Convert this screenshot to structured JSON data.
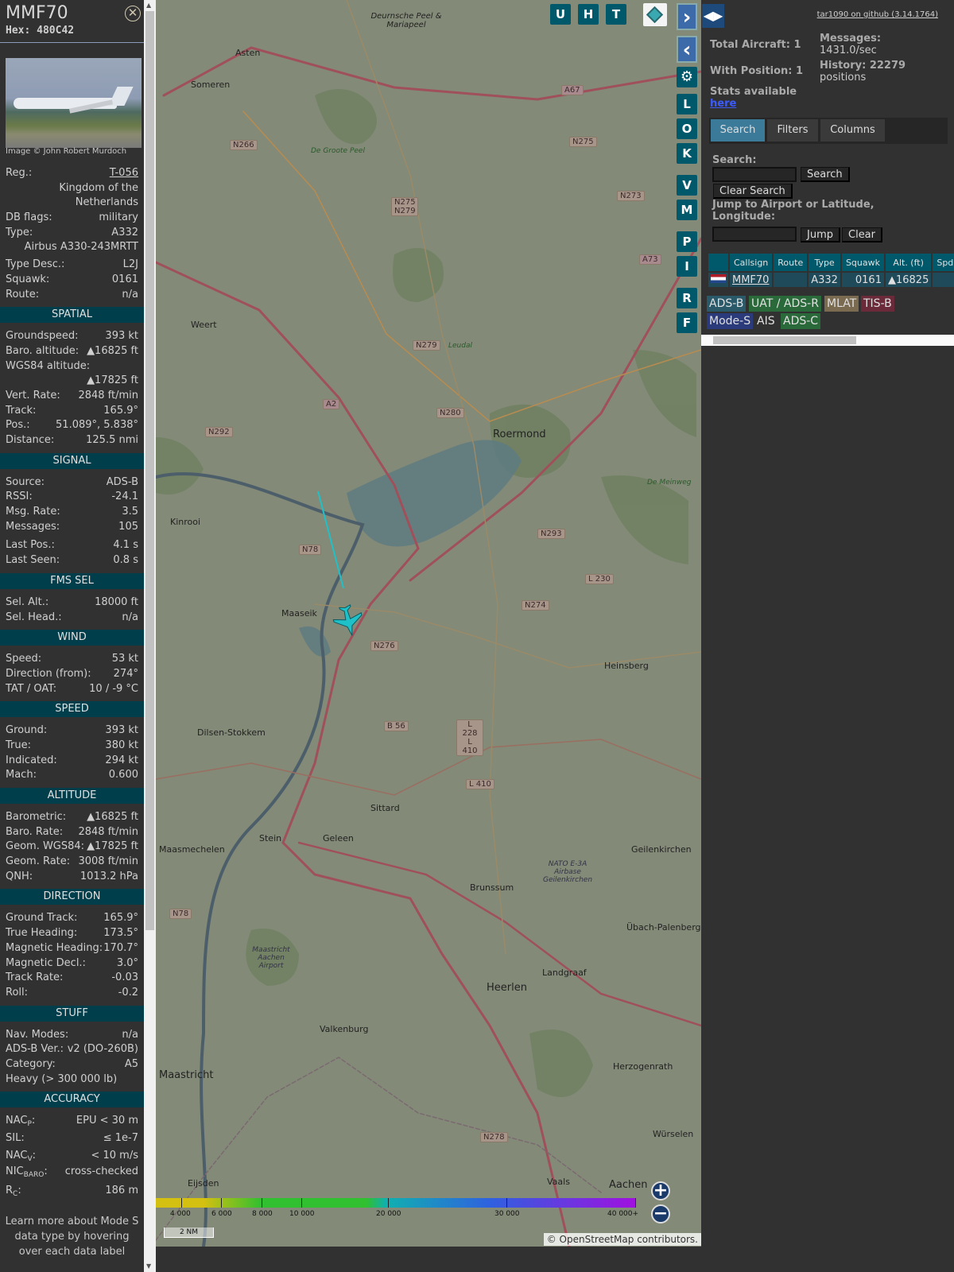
{
  "aircraft": {
    "callsign": "MMF70",
    "hex": "Hex: 480C42",
    "photo_credit": "Image © John Robert Murdoch",
    "reg_label": "Reg.:",
    "reg": "T-056",
    "country_1": "Kingdom of the",
    "country_2": "Netherlands",
    "db_flags_label": "DB flags:",
    "db_flags": "military",
    "type_label": "Type:",
    "type": "A332",
    "type_name": "Airbus A330-243MRTT",
    "type_desc_label": "Type Desc.:",
    "type_desc": "L2J",
    "squawk_label": "Squawk:",
    "squawk": "0161",
    "route_label": "Route:",
    "route": "n/a"
  },
  "sections": {
    "spatial": {
      "title": "SPATIAL",
      "rows": [
        [
          "Groundspeed:",
          "393 kt"
        ],
        [
          "Baro. altitude:",
          "▲16825 ft"
        ],
        [
          "WGS84 altitude:",
          ""
        ],
        [
          "",
          "▲17825 ft"
        ],
        [
          "Vert. Rate:",
          "2848 ft/min"
        ],
        [
          "Track:",
          "165.9°"
        ],
        [
          "Pos.:",
          "51.089°, 5.838°"
        ],
        [
          "Distance:",
          "125.5 nmi"
        ]
      ]
    },
    "signal": {
      "title": "SIGNAL",
      "rows": [
        [
          "Source:",
          "ADS-B"
        ],
        [
          "RSSI:",
          "-24.1"
        ],
        [
          "Msg. Rate:",
          "3.5"
        ],
        [
          "Messages:",
          "105"
        ],
        [
          "Last Pos.:",
          "4.1 s"
        ],
        [
          "Last Seen:",
          "0.8 s"
        ]
      ]
    },
    "fms": {
      "title": "FMS SEL",
      "rows": [
        [
          "Sel. Alt.:",
          "18000 ft"
        ],
        [
          "Sel. Head.:",
          "n/a"
        ]
      ]
    },
    "wind": {
      "title": "WIND",
      "rows": [
        [
          "Speed:",
          "53 kt"
        ],
        [
          "Direction (from):",
          "274°"
        ],
        [
          "TAT / OAT:",
          "10 / -9 °C"
        ]
      ]
    },
    "speed": {
      "title": "SPEED",
      "rows": [
        [
          "Ground:",
          "393 kt"
        ],
        [
          "True:",
          "380 kt"
        ],
        [
          "Indicated:",
          "294 kt"
        ],
        [
          "Mach:",
          "0.600"
        ]
      ]
    },
    "altitude": {
      "title": "ALTITUDE",
      "rows": [
        [
          "Barometric:",
          "▲16825 ft"
        ],
        [
          "Baro. Rate:",
          "2848 ft/min"
        ],
        [
          "Geom. WGS84:",
          "▲17825 ft"
        ],
        [
          "Geom. Rate:",
          "3008 ft/min"
        ],
        [
          "QNH:",
          "1013.2 hPa"
        ]
      ]
    },
    "direction": {
      "title": "DIRECTION",
      "rows": [
        [
          "Ground Track:",
          "165.9°"
        ],
        [
          "True Heading:",
          "173.5°"
        ],
        [
          "Magnetic Heading:",
          "170.7°"
        ],
        [
          "Magnetic Decl.:",
          "3.0°"
        ],
        [
          "Track Rate:",
          "-0.03"
        ],
        [
          "Roll:",
          "-0.2"
        ]
      ]
    },
    "stuff": {
      "title": "STUFF",
      "rows": [
        [
          "Nav. Modes:",
          "n/a"
        ],
        [
          "ADS-B Ver.:",
          "v2 (DO-260B)"
        ],
        [
          "Category:",
          "A5"
        ]
      ],
      "category_desc": "Heavy (> 300 000 lb)"
    },
    "accuracy": {
      "title": "ACCURACY",
      "nacp": "NAC",
      "nacp_sub": "P",
      "nacp_val": "EPU < 30 m",
      "sil": "SIL:",
      "sil_val": "≤ 1e-7",
      "nacv": "NAC",
      "nacv_sub": "V",
      "nacv_val": "< 10 m/s",
      "nicbaro": "NIC",
      "nicbaro_sub": "BARO",
      "nicbaro_val": "cross-checked",
      "rc": "R",
      "rc_sub": "C",
      "rc_val": "186 m"
    },
    "learn_more": "Learn more about Mode S data type by hovering over each data label"
  },
  "map": {
    "buttons_top": [
      "U",
      "H",
      "T"
    ],
    "buttons_side": [
      "L",
      "O",
      "K",
      "V",
      "M",
      "P",
      "I",
      "R",
      "F"
    ],
    "places": [
      "Asten",
      "Someren",
      "Weert",
      "Kinrooi",
      "Maaseik",
      "Roermond",
      "Dilsen-Stokkem",
      "Sittard",
      "Geleen",
      "Stein",
      "Maasmechelen",
      "Brunssum",
      "Heinsberg",
      "Geilenkirchen",
      "Übach-Palenberg",
      "Landgraaf",
      "Heerlen",
      "Valkenburg",
      "Maastricht",
      "Herzogenrath",
      "Würselen",
      "Eijsden",
      "Vaals",
      "Aachen",
      "Deurnsche Peel & Mariapeel",
      "De Groote Peel",
      "Leudal",
      "De Meinweg",
      "NATO E-3A Airbase Geilenkirchen",
      "Maastricht Aachen Airport"
    ],
    "shields": [
      "N266",
      "N275",
      "N275 N279",
      "N273",
      "A67",
      "A73",
      "N279",
      "A2",
      "N280",
      "N292",
      "N78",
      "N293",
      "L 230",
      "N274",
      "N276",
      "B 56",
      "L 228 L 410",
      "L 410",
      "N78",
      "N278"
    ],
    "colorbar_ticks": [
      "4 000",
      "6 000",
      "8 000",
      "10 000",
      "20 000",
      "30 000",
      "40 000+"
    ],
    "scale": "2 NM",
    "attribution_prefix": "© ",
    "attribution_link": "OpenStreetMap",
    "attribution_suffix": " contributors."
  },
  "right": {
    "github": "tar1090 on github (3.14.1764)",
    "total_aircraft": "Total Aircraft: 1",
    "with_position": "With Position: 1",
    "stats_available": "Stats available",
    "stats_link": "here",
    "messages_label": "Messages:",
    "messages": "1431.0/sec",
    "history_label": "History: 22279",
    "history_unit": "positions",
    "tabs": [
      "Search",
      "Filters",
      "Columns"
    ],
    "search_label": "Search:",
    "search_value": "",
    "search_button": "Search",
    "clear_search": "Clear Search",
    "jump_label": "Jump to Airport or Latitude, Longitude:",
    "jump_value": "",
    "jump_button": "Jump",
    "clear_button": "Clear",
    "table": {
      "headers": [
        "",
        "Callsign",
        "Route",
        "Type",
        "Squawk",
        "Alt. (ft)",
        "Spd"
      ],
      "rows": [
        {
          "callsign": "MMF70",
          "route": "",
          "type": "A332",
          "squawk": "0161",
          "alt": "▲16825",
          "spd": ""
        }
      ]
    },
    "sources": [
      "ADS-B",
      "UAT / ADS-R",
      "MLAT",
      "TIS-B",
      "Mode-S",
      "AIS",
      "ADS-C"
    ]
  }
}
